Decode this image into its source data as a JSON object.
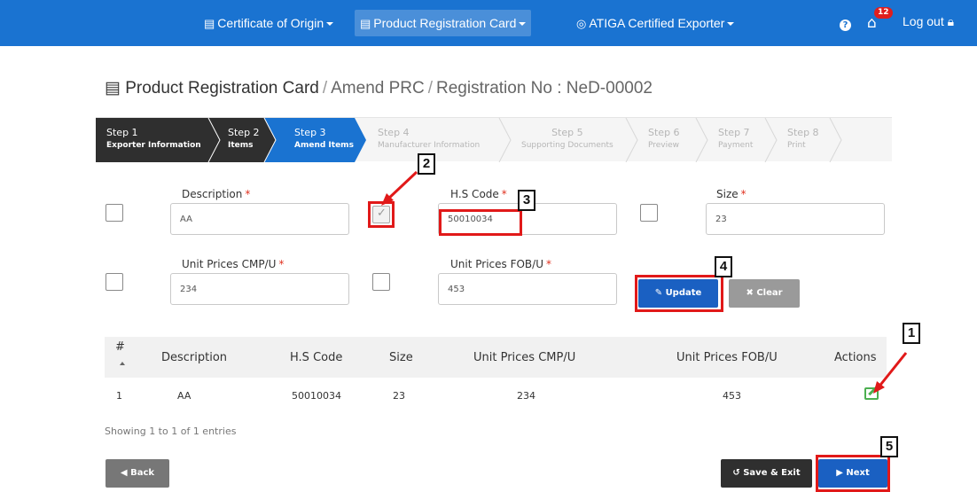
{
  "nav": {
    "items": [
      {
        "label": "Certificate of Origin",
        "icon": "certificate-icon"
      },
      {
        "label": "Product Registration Card",
        "icon": "registration-card-icon"
      },
      {
        "label": "ATIGA Certified Exporter",
        "icon": "exporter-icon"
      }
    ],
    "notification_count": "12",
    "logout_label": "Log out"
  },
  "breadcrumb": {
    "root": "Product Registration Card",
    "section": "Amend PRC",
    "record": "Registration No : NeD-00002"
  },
  "wizard": {
    "steps": [
      {
        "title": "Step 1",
        "desc": "Exporter Information",
        "state": "done"
      },
      {
        "title": "Step 2",
        "desc": "Items",
        "state": "done"
      },
      {
        "title": "Step 3",
        "desc": "Amend Items",
        "state": "active"
      },
      {
        "title": "Step 4",
        "desc": "Manufacturer Information",
        "state": "todo"
      },
      {
        "title": "Step 5",
        "desc": "Supporting Documents",
        "state": "todo"
      },
      {
        "title": "Step 6",
        "desc": "Preview",
        "state": "todo"
      },
      {
        "title": "Step 7",
        "desc": "Payment",
        "state": "todo"
      },
      {
        "title": "Step 8",
        "desc": "Print",
        "state": "todo"
      }
    ]
  },
  "form": {
    "description": {
      "label": "Description",
      "value": "AA",
      "checked": false
    },
    "hs_code": {
      "label": "H.S Code",
      "value": "50010034",
      "checked": true
    },
    "size": {
      "label": "Size",
      "value": "23",
      "checked": false
    },
    "unit_price_cmp": {
      "label": "Unit Prices CMP/U",
      "value": "234",
      "checked": false
    },
    "unit_price_fob": {
      "label": "Unit Prices FOB/U",
      "value": "453",
      "checked": false
    },
    "required_mark": "*",
    "update_label": "Update",
    "clear_label": "Clear"
  },
  "table": {
    "headers": [
      "#",
      "Description",
      "H.S Code",
      "Size",
      "Unit Prices CMP/U",
      "Unit Prices FOB/U",
      "Actions"
    ],
    "rows": [
      {
        "no": "1",
        "description": "AA",
        "hs_code": "50010034",
        "size": "23",
        "cmp": "234",
        "fob": "453"
      }
    ],
    "info": "Showing 1 to 1 of 1 entries"
  },
  "footer": {
    "back_label": "Back",
    "save_exit_label": "Save & Exit",
    "next_label": "Next"
  },
  "annotations": [
    "1",
    "2",
    "3",
    "4",
    "5"
  ],
  "colors": {
    "nav_blue": "#1a73d1",
    "dark_step": "#2f2f2f",
    "annotation_red": "#e11919",
    "edit_green": "#4caf50"
  }
}
